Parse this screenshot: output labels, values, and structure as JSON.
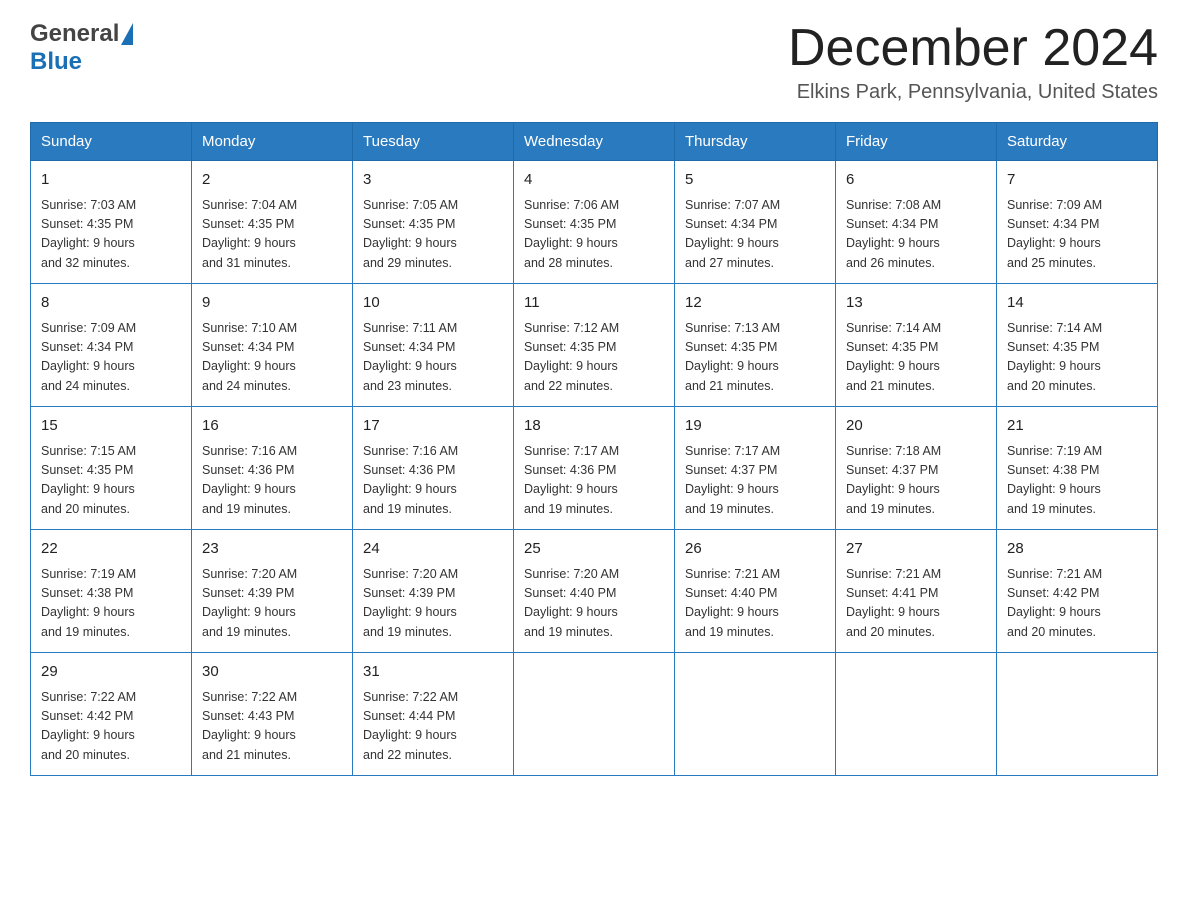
{
  "header": {
    "logo_general": "General",
    "logo_blue": "Blue",
    "title": "December 2024",
    "subtitle": "Elkins Park, Pennsylvania, United States"
  },
  "days_of_week": [
    "Sunday",
    "Monday",
    "Tuesday",
    "Wednesday",
    "Thursday",
    "Friday",
    "Saturday"
  ],
  "weeks": [
    [
      {
        "num": "1",
        "sunrise": "7:03 AM",
        "sunset": "4:35 PM",
        "daylight": "9 hours and 32 minutes."
      },
      {
        "num": "2",
        "sunrise": "7:04 AM",
        "sunset": "4:35 PM",
        "daylight": "9 hours and 31 minutes."
      },
      {
        "num": "3",
        "sunrise": "7:05 AM",
        "sunset": "4:35 PM",
        "daylight": "9 hours and 29 minutes."
      },
      {
        "num": "4",
        "sunrise": "7:06 AM",
        "sunset": "4:35 PM",
        "daylight": "9 hours and 28 minutes."
      },
      {
        "num": "5",
        "sunrise": "7:07 AM",
        "sunset": "4:34 PM",
        "daylight": "9 hours and 27 minutes."
      },
      {
        "num": "6",
        "sunrise": "7:08 AM",
        "sunset": "4:34 PM",
        "daylight": "9 hours and 26 minutes."
      },
      {
        "num": "7",
        "sunrise": "7:09 AM",
        "sunset": "4:34 PM",
        "daylight": "9 hours and 25 minutes."
      }
    ],
    [
      {
        "num": "8",
        "sunrise": "7:09 AM",
        "sunset": "4:34 PM",
        "daylight": "9 hours and 24 minutes."
      },
      {
        "num": "9",
        "sunrise": "7:10 AM",
        "sunset": "4:34 PM",
        "daylight": "9 hours and 24 minutes."
      },
      {
        "num": "10",
        "sunrise": "7:11 AM",
        "sunset": "4:34 PM",
        "daylight": "9 hours and 23 minutes."
      },
      {
        "num": "11",
        "sunrise": "7:12 AM",
        "sunset": "4:35 PM",
        "daylight": "9 hours and 22 minutes."
      },
      {
        "num": "12",
        "sunrise": "7:13 AM",
        "sunset": "4:35 PM",
        "daylight": "9 hours and 21 minutes."
      },
      {
        "num": "13",
        "sunrise": "7:14 AM",
        "sunset": "4:35 PM",
        "daylight": "9 hours and 21 minutes."
      },
      {
        "num": "14",
        "sunrise": "7:14 AM",
        "sunset": "4:35 PM",
        "daylight": "9 hours and 20 minutes."
      }
    ],
    [
      {
        "num": "15",
        "sunrise": "7:15 AM",
        "sunset": "4:35 PM",
        "daylight": "9 hours and 20 minutes."
      },
      {
        "num": "16",
        "sunrise": "7:16 AM",
        "sunset": "4:36 PM",
        "daylight": "9 hours and 19 minutes."
      },
      {
        "num": "17",
        "sunrise": "7:16 AM",
        "sunset": "4:36 PM",
        "daylight": "9 hours and 19 minutes."
      },
      {
        "num": "18",
        "sunrise": "7:17 AM",
        "sunset": "4:36 PM",
        "daylight": "9 hours and 19 minutes."
      },
      {
        "num": "19",
        "sunrise": "7:17 AM",
        "sunset": "4:37 PM",
        "daylight": "9 hours and 19 minutes."
      },
      {
        "num": "20",
        "sunrise": "7:18 AM",
        "sunset": "4:37 PM",
        "daylight": "9 hours and 19 minutes."
      },
      {
        "num": "21",
        "sunrise": "7:19 AM",
        "sunset": "4:38 PM",
        "daylight": "9 hours and 19 minutes."
      }
    ],
    [
      {
        "num": "22",
        "sunrise": "7:19 AM",
        "sunset": "4:38 PM",
        "daylight": "9 hours and 19 minutes."
      },
      {
        "num": "23",
        "sunrise": "7:20 AM",
        "sunset": "4:39 PM",
        "daylight": "9 hours and 19 minutes."
      },
      {
        "num": "24",
        "sunrise": "7:20 AM",
        "sunset": "4:39 PM",
        "daylight": "9 hours and 19 minutes."
      },
      {
        "num": "25",
        "sunrise": "7:20 AM",
        "sunset": "4:40 PM",
        "daylight": "9 hours and 19 minutes."
      },
      {
        "num": "26",
        "sunrise": "7:21 AM",
        "sunset": "4:40 PM",
        "daylight": "9 hours and 19 minutes."
      },
      {
        "num": "27",
        "sunrise": "7:21 AM",
        "sunset": "4:41 PM",
        "daylight": "9 hours and 20 minutes."
      },
      {
        "num": "28",
        "sunrise": "7:21 AM",
        "sunset": "4:42 PM",
        "daylight": "9 hours and 20 minutes."
      }
    ],
    [
      {
        "num": "29",
        "sunrise": "7:22 AM",
        "sunset": "4:42 PM",
        "daylight": "9 hours and 20 minutes."
      },
      {
        "num": "30",
        "sunrise": "7:22 AM",
        "sunset": "4:43 PM",
        "daylight": "9 hours and 21 minutes."
      },
      {
        "num": "31",
        "sunrise": "7:22 AM",
        "sunset": "4:44 PM",
        "daylight": "9 hours and 22 minutes."
      },
      null,
      null,
      null,
      null
    ]
  ],
  "labels": {
    "sunrise": "Sunrise:",
    "sunset": "Sunset:",
    "daylight": "Daylight:"
  }
}
